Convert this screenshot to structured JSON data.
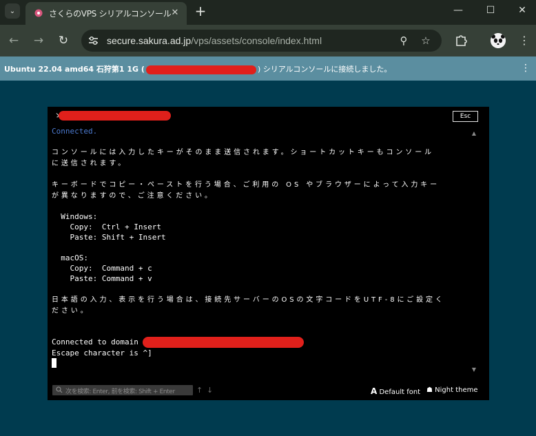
{
  "browser": {
    "tab_title": "さくらのVPS シリアルコンソール",
    "tab_close": "✕",
    "new_tab": "+",
    "url_host": "secure.sakura.ad.jp",
    "url_path": "/vps/assets/console/index.html"
  },
  "banner": {
    "prefix": "Ubuntu 22.04 amd64 石狩第1 1G (",
    "suffix": ") シリアルコンソールに接続しました。",
    "menu": "⋮"
  },
  "console": {
    "esc_label": "Esc",
    "prompt_prefix": "ゝ.",
    "connected": "Connected.",
    "line_1a": "コンソールには入力したキーがそのまま送信されます。ショートカットキーもコンソール",
    "line_1b": "に送信されます。",
    "line_2a": "キーボードでコピー・ペーストを行う場合、ご利用の OS やブラウザーによって入力キー",
    "line_2b": "が異なりますので、ご注意ください。",
    "windows_header": "Windows:",
    "win_copy": "Copy:  Ctrl + Insert",
    "win_paste": "Paste: Shift + Insert",
    "mac_header": "macOS:",
    "mac_copy": "Copy:  Command + c",
    "mac_paste": "Paste: Command + v",
    "line_3a": "日本語の入力、表示を行う場合は、接続先サーバーのOSの文字コードをUTF-8にご設定く",
    "line_3b": "ださい。",
    "connected_domain": "Connected to domain ",
    "escape_char": "Escape character is ^]",
    "search_placeholder": "次を検索: Enter, 前を検索: Shift + Enter",
    "default_font": "Default font",
    "night_theme": "Night theme"
  },
  "colors": {
    "background": "#003b4f",
    "banner": "#5b8ea0",
    "redaction": "#e0201b",
    "connected_text": "#4d7bd1"
  }
}
